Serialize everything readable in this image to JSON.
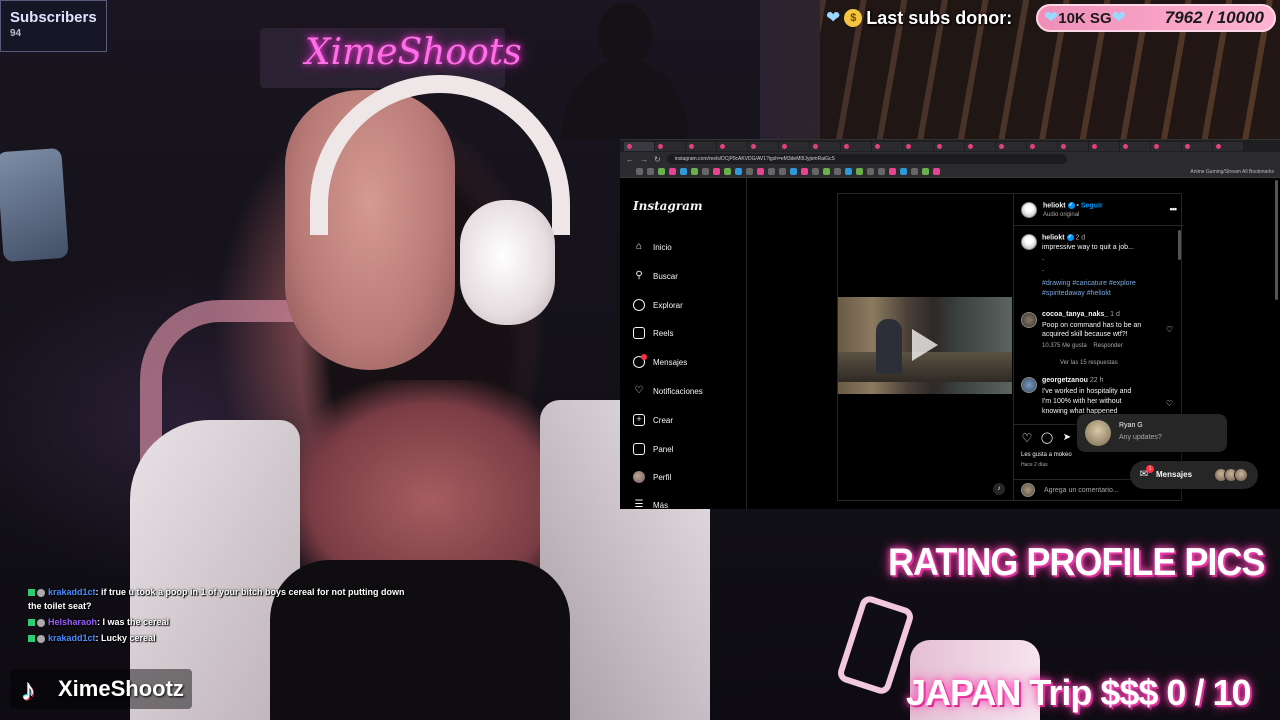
{
  "subscribers": {
    "label": "Subscribers",
    "count": "94"
  },
  "donor": {
    "label": "Last subs donor:",
    "goal_name": "10K SG",
    "goal_count": "7962 / 10000"
  },
  "browser": {
    "url": "instagram.com/reels/DCjP0cAKVDG/AV1?igsh=eM3deM0IJyjemRaiGcS",
    "bookmarks_text": "Anime    Gaming/Stream    All Bookmarks"
  },
  "instagram": {
    "logo": "Instagram",
    "nav": [
      {
        "label": "Inicio",
        "icon": "home-icon"
      },
      {
        "label": "Buscar",
        "icon": "search-icon"
      },
      {
        "label": "Explorar",
        "icon": "compass-icon"
      },
      {
        "label": "Reels",
        "icon": "reels-icon"
      },
      {
        "label": "Mensajes",
        "icon": "messenger-icon"
      },
      {
        "label": "Notificaciones",
        "icon": "heart-icon"
      },
      {
        "label": "Crear",
        "icon": "plus-icon"
      },
      {
        "label": "Panel",
        "icon": "dashboard-icon"
      },
      {
        "label": "Perfil",
        "icon": "avatar-icon"
      },
      {
        "label": "Más",
        "icon": "menu-icon"
      }
    ],
    "post": {
      "author": "heliokt",
      "follow": "Seguir",
      "audio": "Audio original",
      "caption_time": "2 d",
      "caption": "impressive way to quit a job...",
      "dots": ".",
      "tags_line1": "#drawing #caricature #explore",
      "tags_line2": "#spiritedaway #heliokt",
      "comments": [
        {
          "user": "cocoa_tanya_naks_",
          "time": "1 d",
          "text1": "Poop on command has to be an",
          "text2": "acquired skill because wtf?!",
          "likes": "10.375 Me gusta",
          "reply": "Responder",
          "replies": "Ver las 15 respuestas"
        },
        {
          "user": "georgetzanou",
          "time": "22 h",
          "text1": "I've worked in hospitality and",
          "text2": "I'm 100% with her without",
          "text3": "knowing what happened"
        }
      ],
      "liked_by": "Les gusta a mokeo",
      "posted": "Hace 2 días",
      "comment_placeholder": "Agrega un comentario..."
    },
    "notification": {
      "name": "Ryan G",
      "message": "Any updates?"
    },
    "messages": {
      "label": "Mensajes",
      "badge": "1"
    }
  },
  "chat": [
    {
      "user": "krakadd1ct",
      "message": ": if true u took a poop in 1 of your bitch boys cereal for not putting down",
      "message2": "the toilet seat?",
      "color": "#4a8bff"
    },
    {
      "user": "Helsharaoh",
      "message": ": I was the cereal",
      "color": "#9a5cff"
    },
    {
      "user": "krakadd1ct",
      "message": ": Lucky cereal",
      "color": "#4a8bff"
    }
  ],
  "streamer": {
    "handle": "XimeShootz",
    "neon_sign": "XimeShoots"
  },
  "overlay": {
    "rating": "RATING PROFILE PICS",
    "japan": "JAPAN Trip $$$  0 / 10"
  },
  "colors": {
    "neon_pink": "#ff2aa8",
    "ig_blue": "#0095f6",
    "goal_pink": "#f08fb8"
  }
}
